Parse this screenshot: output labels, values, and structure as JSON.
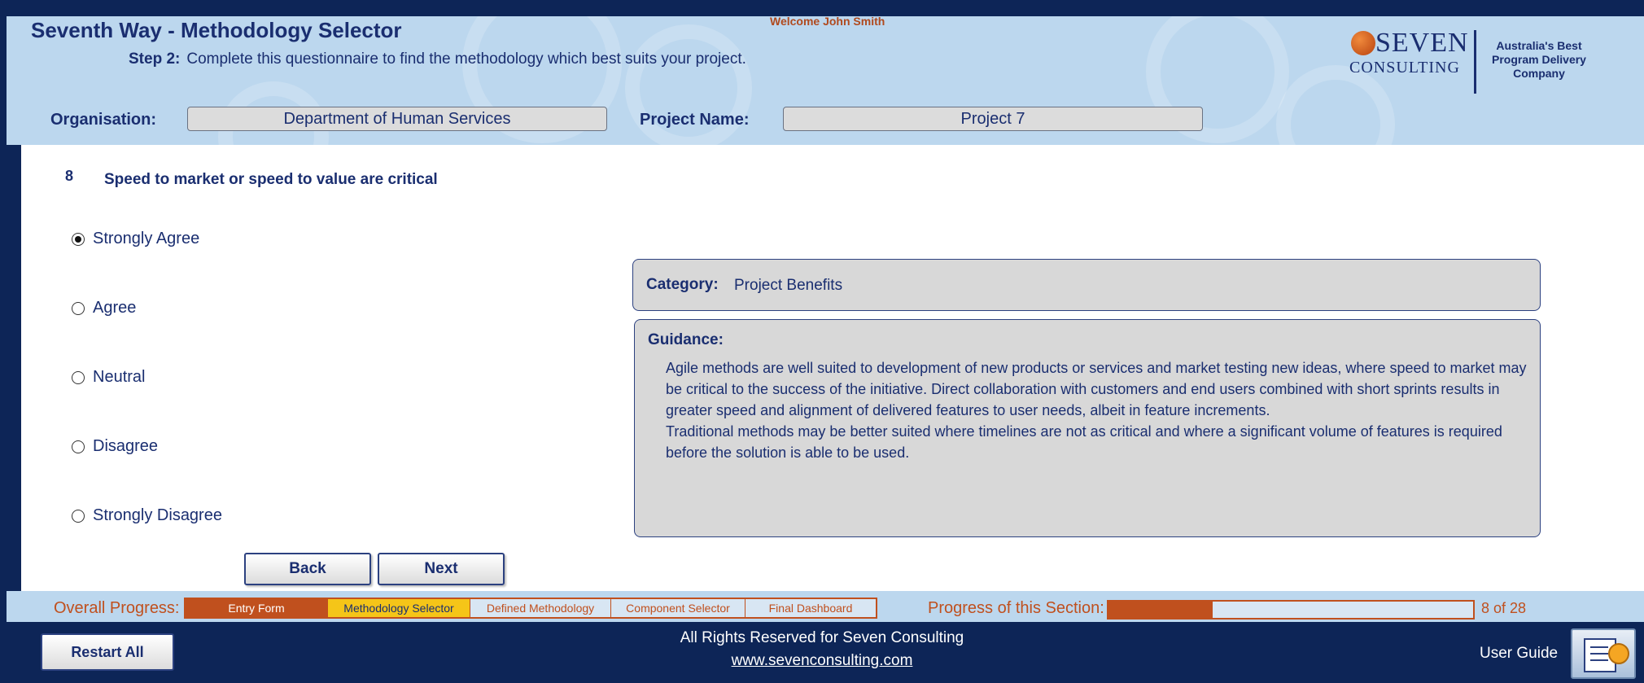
{
  "welcome": "Welcome John Smith",
  "title": "Seventh Way - Methodology Selector",
  "step": {
    "label": "Step 2:",
    "text": "Complete this questionnaire to find the methodology which best suits your project."
  },
  "logo": {
    "brand_top": "SEVEN",
    "brand_bottom": "CONSULTING",
    "tagline": "Australia's Best Program Delivery Company"
  },
  "organisation": {
    "label": "Organisation:",
    "value": "Department of Human Services"
  },
  "project": {
    "label": "Project Name:",
    "value": "Project 7"
  },
  "question": {
    "number": "8",
    "text": "Speed to market or speed to value are critical"
  },
  "options": [
    "Strongly Agree",
    "Agree",
    "Neutral",
    "Disagree",
    "Strongly Disagree"
  ],
  "selected_option": "Strongly Agree",
  "buttons": {
    "back": "Back",
    "next": "Next",
    "restart": "Restart All"
  },
  "category": {
    "label": "Category:",
    "value": "Project Benefits"
  },
  "guidance": {
    "label": "Guidance:",
    "text": "Agile methods are well suited to development of new products or services and market testing new ideas, where speed to market may be critical to the success of the initiative. Direct collaboration with customers and end users combined with short sprints results in greater speed and alignment of delivered features to user needs, albeit in feature increments.\nTraditional methods may be better suited where timelines are not as critical and where a significant volume of features is required before the solution is able to be used."
  },
  "overall_progress": {
    "label": "Overall Progress:",
    "stages": [
      "Entry Form",
      "Methodology Selector",
      "Defined Methodology",
      "Component Selector",
      "Final Dashboard"
    ],
    "completed": [
      "Entry Form"
    ],
    "current": "Methodology Selector"
  },
  "section_progress": {
    "label": "Progress of this Section:",
    "count_text": "8  of  28",
    "fraction": 0.286
  },
  "footer": {
    "rights": "All Rights Reserved for Seven Consulting",
    "link": "www.sevenconsulting.com"
  },
  "user_guide": "User Guide",
  "colors": {
    "navy": "#0d2557",
    "header_bg": "#bcd7ee",
    "accent_orange": "#c0501e",
    "current_stage": "#f5c518",
    "text_navy": "#1a2e70"
  }
}
